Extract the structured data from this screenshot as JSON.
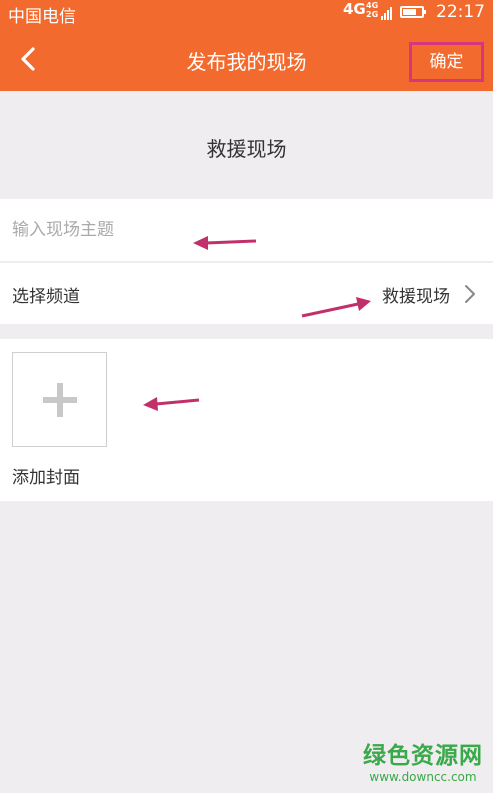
{
  "status_bar": {
    "carrier": "中国电信",
    "network": "4G",
    "network_small": "4G\n2G",
    "time": "22:17",
    "battery_level": 0.7
  },
  "title_bar": {
    "title": "发布我的现场",
    "confirm_label": "确定",
    "back_icon": "chevron-left-icon"
  },
  "header": {
    "label": "救援现场"
  },
  "form": {
    "subject_placeholder": "输入现场主题",
    "subject_value": "",
    "channel_label": "选择频道",
    "channel_value": "救援现场",
    "channel_icon": "chevron-right-icon"
  },
  "cover": {
    "add_icon": "plus-icon",
    "label": "添加封面"
  },
  "watermark": {
    "name": "绿色资源网",
    "url": "www.downcc.com"
  },
  "colors": {
    "accent": "#f26a2d",
    "highlight": "#d8357f",
    "background": "#efedf0"
  }
}
